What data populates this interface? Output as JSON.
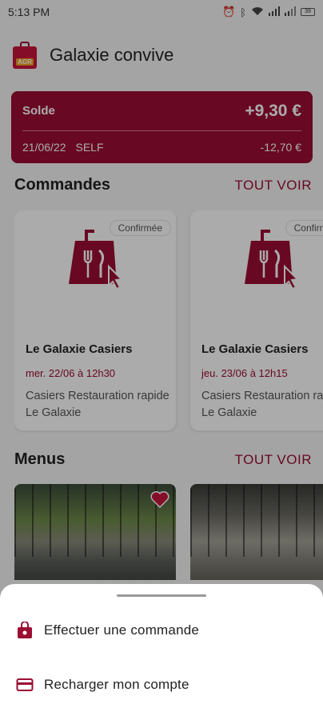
{
  "status_bar": {
    "time": "5:13 PM",
    "battery": "39"
  },
  "header": {
    "title": "Galaxie convive",
    "logo_text": "AGR"
  },
  "balance": {
    "label": "Solde",
    "value": "+9,30 €",
    "last_date": "21/06/22",
    "last_place": "SELF",
    "last_amount": "-12,70 €"
  },
  "orders": {
    "title": "Commandes",
    "see_all": "TOUT VOIR",
    "items": [
      {
        "status": "Confirmée",
        "name": "Le Galaxie Casiers",
        "date": "mer. 22/06 à 12h30",
        "place": "Casiers Restauration rapide Le Galaxie"
      },
      {
        "status": "Confirmée",
        "name": "Le Galaxie Casiers",
        "date": "jeu. 23/06 à 12h15",
        "place": "Casiers Restauration rapide Le Galaxie"
      }
    ]
  },
  "menus": {
    "title": "Menus",
    "see_all": "TOUT VOIR",
    "items": [
      {
        "image": "restaurant-photo",
        "favorite": true
      },
      {
        "image": "restaurant-photo",
        "favorite": false
      }
    ]
  },
  "sheet": {
    "items": [
      {
        "icon": "shopping-bag-icon",
        "label": "Effectuer une commande"
      },
      {
        "icon": "credit-card-icon",
        "label": "Recharger mon compte"
      }
    ]
  },
  "colors": {
    "accent": "#9b0d33",
    "logo_red": "#c8143c",
    "logo_orange": "#f0a020"
  }
}
